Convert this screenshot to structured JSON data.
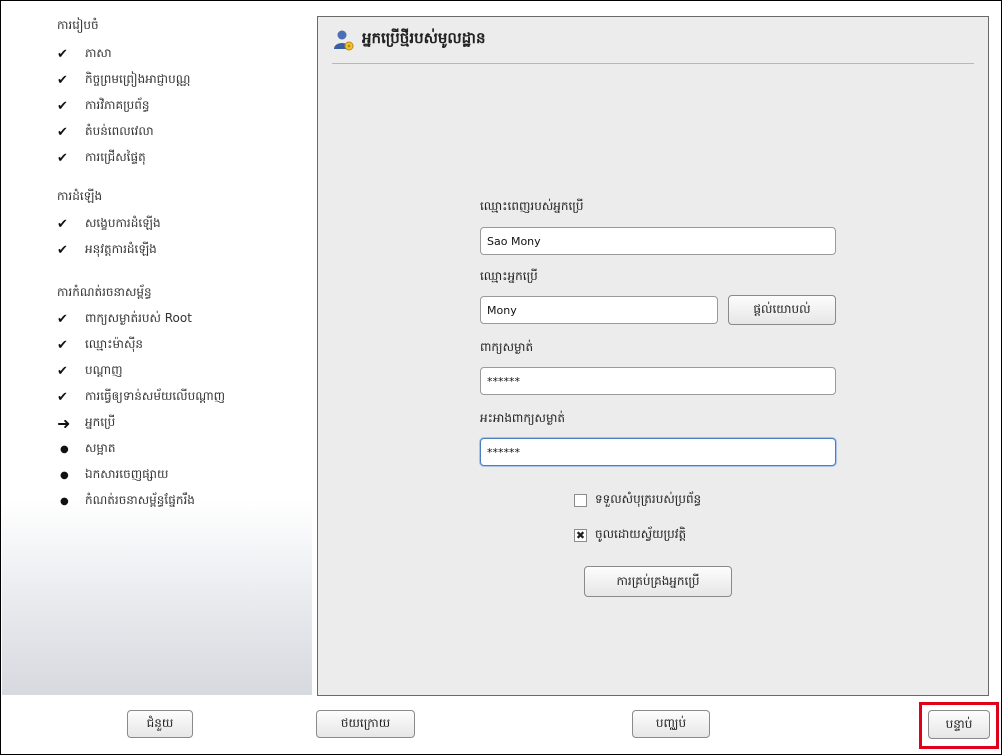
{
  "sidebar": {
    "sections": [
      {
        "title": "ការរៀបចំ",
        "steps": [
          {
            "label": "ភាសា",
            "state": "done"
          },
          {
            "label": "កិច្ចព្រមព្រៀងអាជ្ញាបណ្ណ",
            "state": "done"
          },
          {
            "label": "ការវិភាគប្រព័ន្ធ",
            "state": "done"
          },
          {
            "label": "តំបន់ពេលវេលា",
            "state": "done"
          },
          {
            "label": "ការជ្រើសផ្ទៃតុ",
            "state": "done"
          }
        ]
      },
      {
        "title": "ការដំឡើង",
        "steps": [
          {
            "label": "សង្ខេបការដំឡើង",
            "state": "done"
          },
          {
            "label": "អនុវត្តការដំឡើង",
            "state": "done"
          }
        ]
      },
      {
        "title": "ការកំណត់រចនាសម្ព័ន្ធ",
        "steps": [
          {
            "label": "ពាក្យសម្ងាត់របស់ Root",
            "state": "done"
          },
          {
            "label": "ឈ្មោះម៉ាស៊ីន",
            "state": "done"
          },
          {
            "label": "បណ្ដាញ",
            "state": "done"
          },
          {
            "label": "ការធ្វើឲ្យទាន់សម័យលើបណ្ដាញ",
            "state": "done"
          },
          {
            "label": "អ្នកប្រើ",
            "state": "current"
          },
          {
            "label": "សម្អាត",
            "state": "pending"
          },
          {
            "label": "ឯកសារចេញផ្សាយ",
            "state": "pending"
          },
          {
            "label": "កំណត់រចនាសម្ព័ន្ធផ្នែករឹង",
            "state": "pending"
          }
        ]
      }
    ]
  },
  "main": {
    "title": "អ្នកប្រើថ្មីរបស់មូលដ្ឋាន",
    "full_name_label": "ឈ្មោះពេញរបស់អ្នកប្រើ",
    "full_name_value": "Sao Mony",
    "username_label": "ឈ្មោះអ្នកប្រើ",
    "username_value": "Mony",
    "suggest_button": "ផ្ដល់យោបល់",
    "password_label": "ពាក្យសម្ងាត់",
    "password_value": "******",
    "confirm_label": "អះអាងពាក្យសម្ងាត់",
    "confirm_value": "******",
    "system_mail_label": "ទទួលសំបុត្ររបស់ប្រព័ន្ធ",
    "system_mail_checked": false,
    "autologin_label": "ចូលដោយស្វ័យប្រវត្តិ",
    "autologin_checked": true,
    "manage_users_button": "ការគ្រប់គ្រងអ្នកប្រើ"
  },
  "footer": {
    "help": "ជំនួយ",
    "back": "ថយក្រោយ",
    "abort": "បញ្ឈប់",
    "next": "បន្ទាប់"
  },
  "colors": {
    "highlight": "#e0001a",
    "focus": "#4a7fc4"
  }
}
